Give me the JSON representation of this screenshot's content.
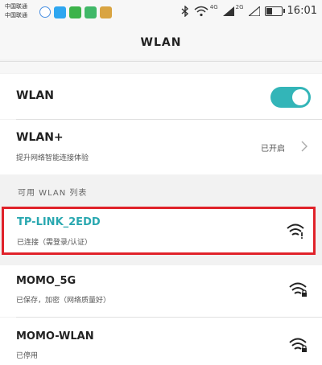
{
  "status_bar": {
    "carrier_line1": "中国联通",
    "carrier_line2": "中国联通",
    "signal_tag_1": "4G",
    "signal_tag_2": "2G",
    "time": "16:01"
  },
  "header": {
    "title": "WLAN"
  },
  "settings": {
    "wlan_label": "WLAN",
    "wlan_toggle_on": true,
    "wlan_plus_label": "WLAN+",
    "wlan_plus_sub": "提升网络智能连接体验",
    "wlan_plus_value": "已开启"
  },
  "section": {
    "available_title": "可用 WLAN 列表"
  },
  "networks": [
    {
      "ssid": "TP-LINK_2EDD",
      "status": "已连接（需登录/认证）",
      "selected": true
    },
    {
      "ssid": "MOMO_5G",
      "status": "已保存，加密（网络质量好）",
      "selected": false
    },
    {
      "ssid": "MOMO-WLAN",
      "status": "已停用",
      "selected": false
    }
  ],
  "colors": {
    "accent": "#33b5b8",
    "highlight_border": "#e0222a",
    "connected_text": "#2aa8b0"
  },
  "icons": [
    "bluetooth-icon",
    "wifi-icon",
    "cell-signal-icon",
    "battery-icon",
    "chevron-right-icon",
    "wifi-lock-icon",
    "wifi-alert-icon"
  ]
}
